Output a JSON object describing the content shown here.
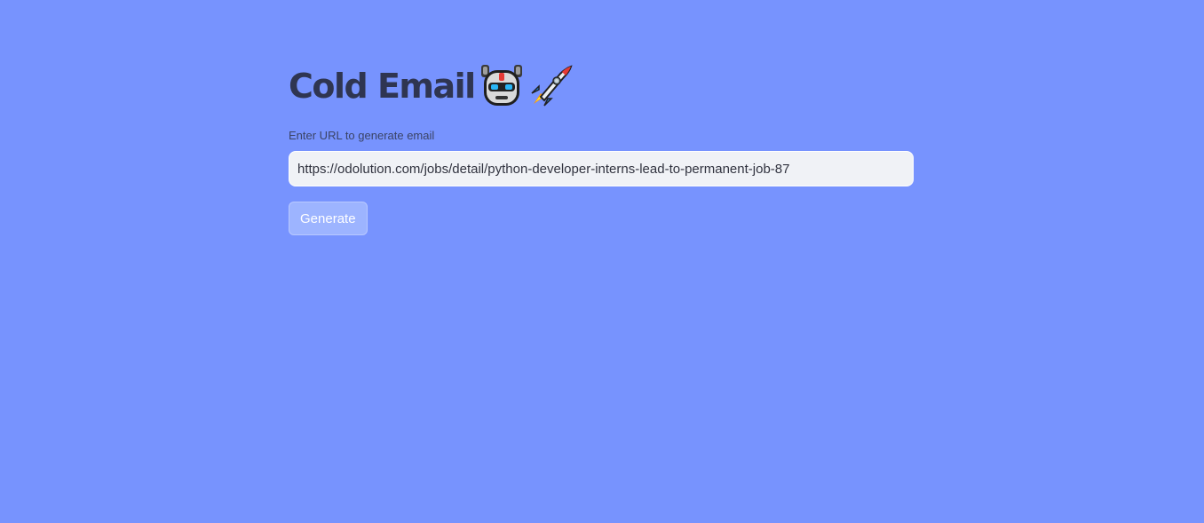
{
  "app": {
    "title": "Cold Email",
    "title_icons": [
      "robot-icon",
      "rocket-icon"
    ]
  },
  "form": {
    "url_label": "Enter URL to generate email",
    "url_value": "https://odolution.com/jobs/detail/python-developer-interns-lead-to-permanent-job-87",
    "generate_label": "Generate"
  },
  "colors": {
    "background": "#7793fe",
    "title": "#2f3551",
    "input_bg": "#f0f2f6",
    "button_bg": "#9db4ff"
  }
}
